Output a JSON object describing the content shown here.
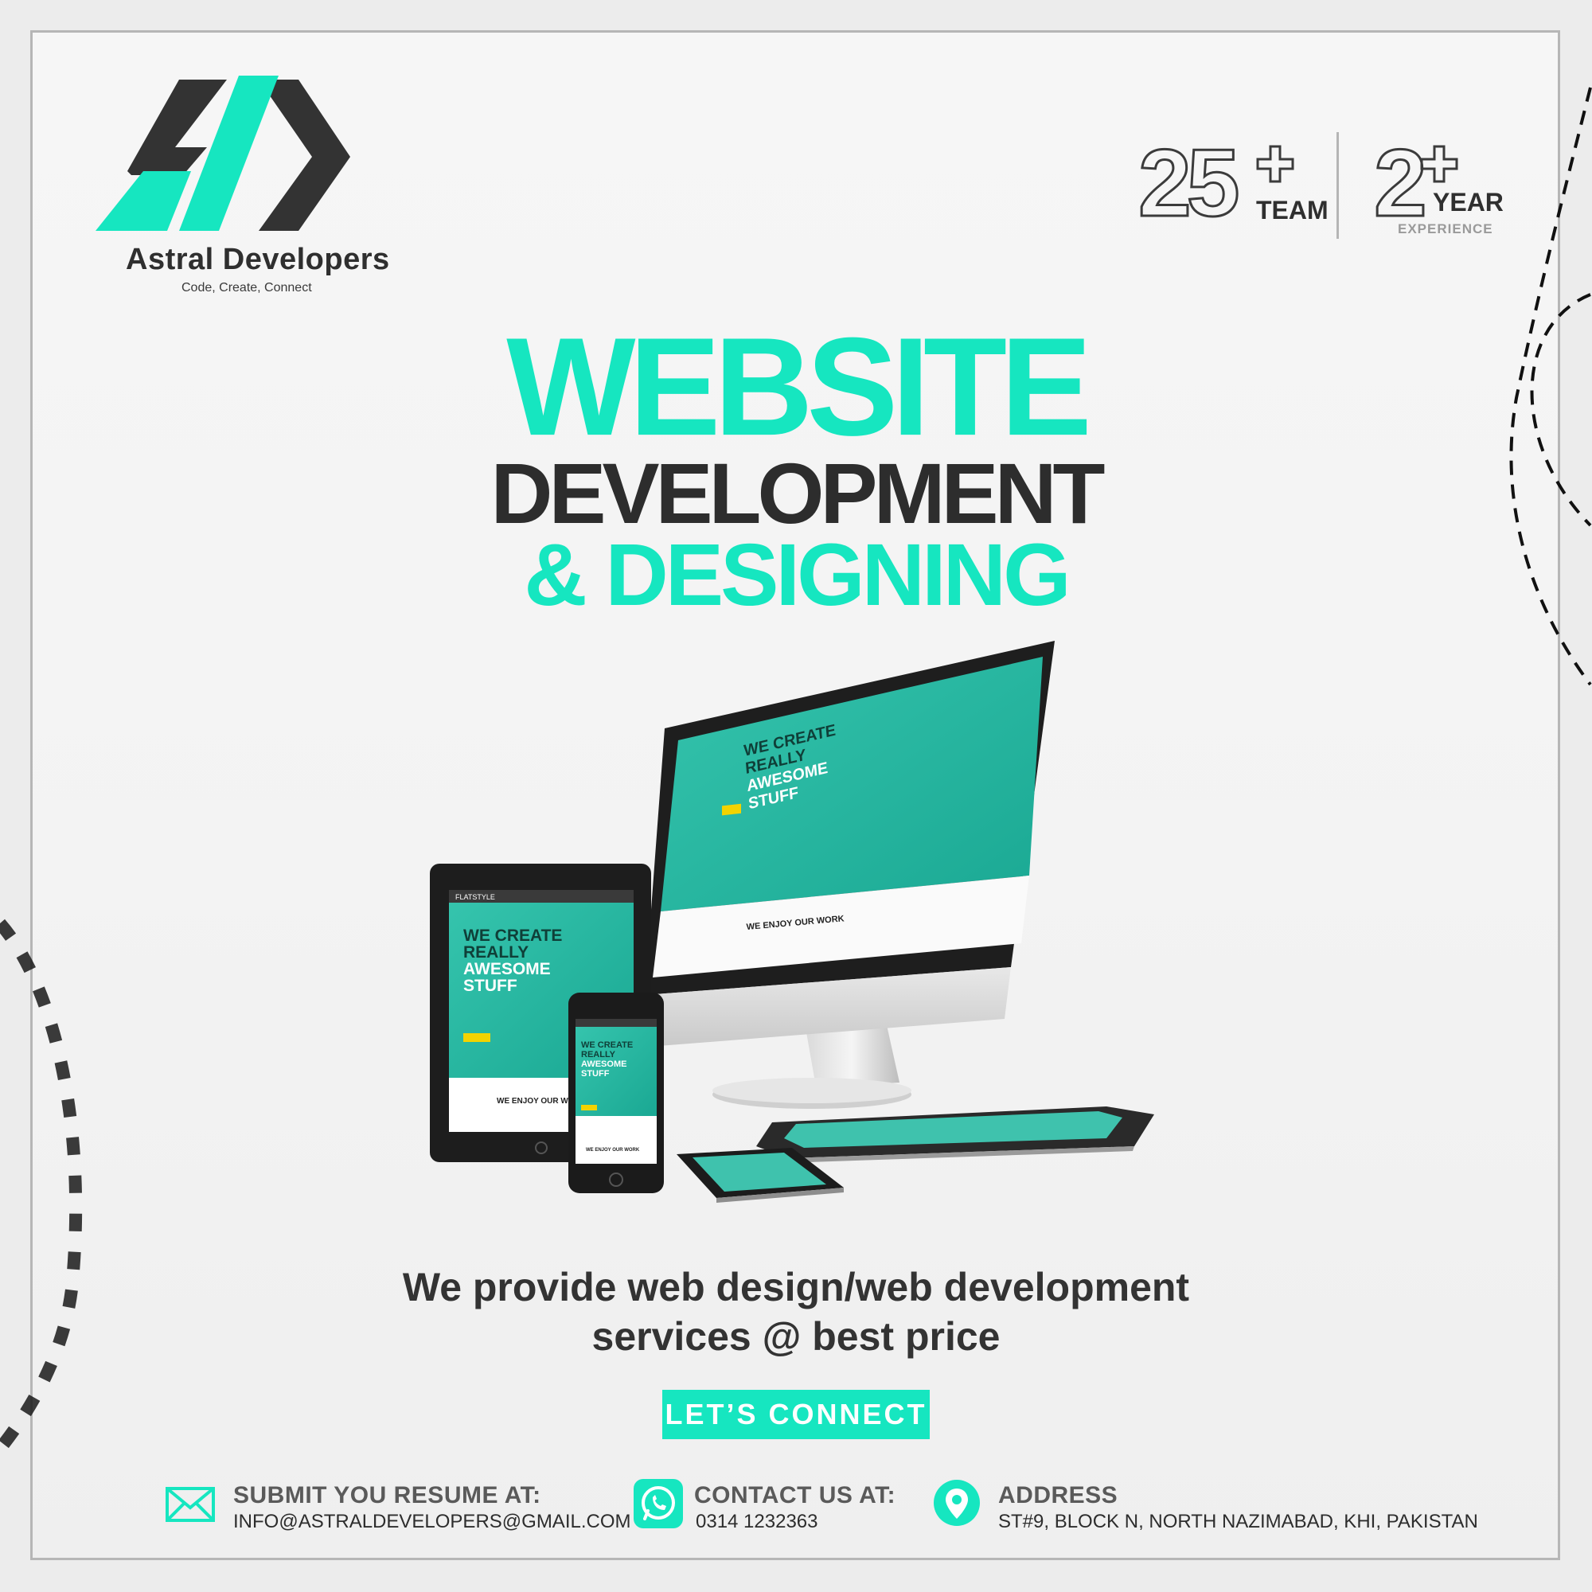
{
  "brand": {
    "name": "Astral Developers",
    "tagline": "Code, Create, Connect"
  },
  "stats": [
    {
      "number": "25",
      "label": "TEAM",
      "sub": ""
    },
    {
      "number": "2",
      "label": "YEAR",
      "sub": "EXPERIENCE"
    }
  ],
  "headline": {
    "line1": "WEBSITE",
    "line2": "DEVELOPMENT",
    "line3": "& DESIGNING"
  },
  "screens": {
    "hero_line1": "WE CREATE",
    "hero_line2": "REALLY",
    "hero_line3": "AWESOME",
    "hero_line4": "STUFF",
    "footer_text": "WE ENJOY OUR WORK",
    "brand_mark": "FLATSTYLE"
  },
  "tagline": {
    "line1": "We provide web design/web development",
    "line2": "services @ best price"
  },
  "cta": {
    "label": "LET’S CONNECT"
  },
  "footer": {
    "resume": {
      "title": "SUBMIT YOU RESUME AT:",
      "value": "INFO@ASTRALDEVELOPERS@GMAIL.COM"
    },
    "contact": {
      "title": "CONTACT US AT:",
      "value": "0314 1232363"
    },
    "address": {
      "title": "ADDRESS",
      "value": "ST#9, BLOCK N, NORTH NAZIMABAD, KHI, PAKISTAN"
    }
  },
  "colors": {
    "accent": "#16e6c0",
    "dark": "#2d2d2d",
    "background": "#f3f3f3"
  },
  "icons": [
    "logo-code-icon",
    "plus-icon",
    "envelope-icon",
    "whatsapp-icon",
    "location-pin-icon"
  ]
}
